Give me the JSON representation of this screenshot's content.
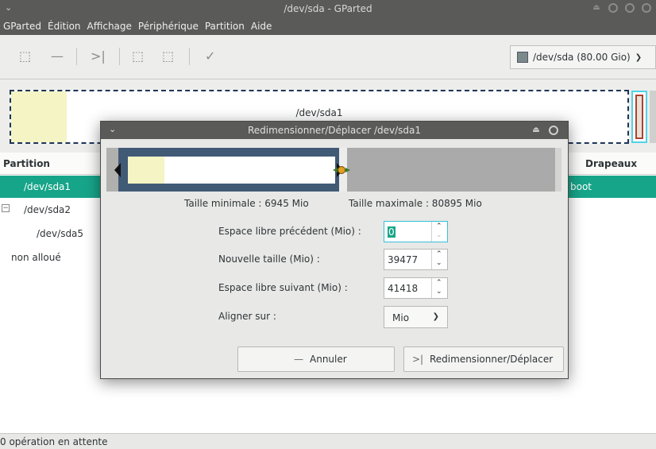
{
  "window": {
    "title": "/dev/sda - GParted"
  },
  "menubar": [
    "GParted",
    "Édition",
    "Affichage",
    "Périphérique",
    "Partition",
    "Aide"
  ],
  "toolbar": {
    "device_selector": "/dev/sda  (80.00 Gio)"
  },
  "graphic": {
    "partition_label": "/dev/sda1"
  },
  "tree": {
    "headers": {
      "partition": "Partition",
      "flags": "Drapeaux"
    },
    "rows": [
      {
        "name": "/dev/sda1",
        "flags": "boot"
      },
      {
        "name": "/dev/sda2",
        "flags": ""
      },
      {
        "name": "/dev/sda5",
        "flags": ""
      },
      {
        "name": "non alloué",
        "flags": ""
      }
    ]
  },
  "status": "0 opération en attente",
  "dialog": {
    "title": "Redimensionner/Déplacer /dev/sda1",
    "min_size": "Taille minimale : 6945 Mio",
    "max_size": "Taille maximale : 80895 Mio",
    "fields": {
      "free_before_label": "Espace libre précédent (Mio) :",
      "free_before_value": "0",
      "new_size_label": "Nouvelle taille (Mio) :",
      "new_size_value": "39477",
      "free_after_label": "Espace libre suivant (Mio) :",
      "free_after_value": "41418",
      "align_label": "Aligner sur :",
      "align_value": "Mio"
    },
    "buttons": {
      "cancel": "Annuler",
      "resize": "Redimensionner/Déplacer"
    }
  }
}
